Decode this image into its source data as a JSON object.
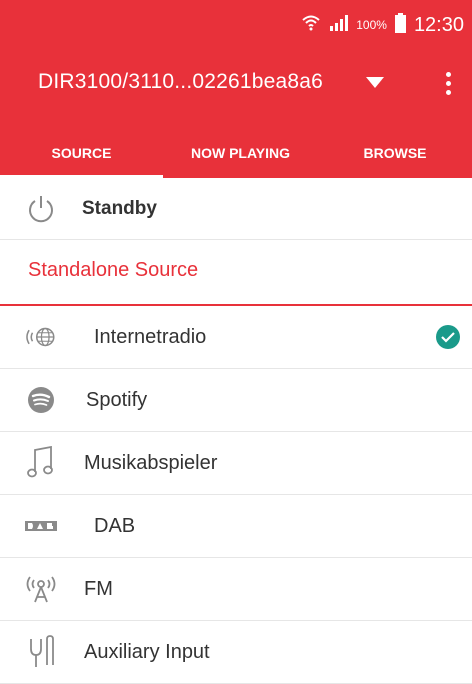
{
  "status_bar": {
    "battery_percent": "100%",
    "time": "12:30",
    "icons": [
      "wifi-icon",
      "signal-icon",
      "battery-icon"
    ]
  },
  "header": {
    "device_name": "DIR3100/3110...02261bea8a6",
    "dropdown_icon": "caret-down-icon",
    "menu_icon": "more-vert-icon"
  },
  "tabs": [
    {
      "label": "SOURCE",
      "active": true
    },
    {
      "label": "NOW PLAYING",
      "active": false
    },
    {
      "label": "BROWSE",
      "active": false
    }
  ],
  "standby": {
    "label": "Standby",
    "icon": "power-icon"
  },
  "section": {
    "label": "Standalone Source"
  },
  "sources": [
    {
      "label": "Internetradio",
      "icon": "internet-radio-icon",
      "selected": true
    },
    {
      "label": "Spotify",
      "icon": "spotify-icon",
      "selected": false
    },
    {
      "label": "Musikabspieler",
      "icon": "music-note-icon",
      "selected": false
    },
    {
      "label": "DAB",
      "icon": "dab-icon",
      "selected": false
    },
    {
      "label": "FM",
      "icon": "fm-antenna-icon",
      "selected": false
    },
    {
      "label": "Auxiliary Input",
      "icon": "aux-input-icon",
      "selected": false
    }
  ],
  "colors": {
    "accent": "#e8313a",
    "check": "#1a9a8a",
    "text": "#333333",
    "icon_gray": "#8a8a8a"
  }
}
